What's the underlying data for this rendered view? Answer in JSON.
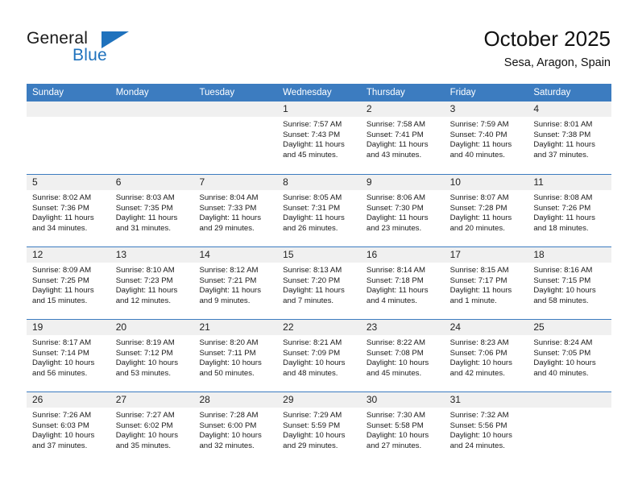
{
  "brand": {
    "name_top": "General",
    "name_bottom": "Blue",
    "accent_color": "#1f72bd"
  },
  "header": {
    "title": "October 2025",
    "location": "Sesa, Aragon, Spain"
  },
  "theme": {
    "header_blue": "#3c7cc0",
    "day_band_gray": "#f0f0f0",
    "text": "#1a1a1a"
  },
  "weekdays": [
    "Sunday",
    "Monday",
    "Tuesday",
    "Wednesday",
    "Thursday",
    "Friday",
    "Saturday"
  ],
  "weeks": [
    [
      {
        "day": "",
        "empty": true
      },
      {
        "day": "",
        "empty": true
      },
      {
        "day": "",
        "empty": true
      },
      {
        "day": "1",
        "sunrise": "Sunrise: 7:57 AM",
        "sunset": "Sunset: 7:43 PM",
        "daylight_1": "Daylight: 11 hours",
        "daylight_2": "and 45 minutes."
      },
      {
        "day": "2",
        "sunrise": "Sunrise: 7:58 AM",
        "sunset": "Sunset: 7:41 PM",
        "daylight_1": "Daylight: 11 hours",
        "daylight_2": "and 43 minutes."
      },
      {
        "day": "3",
        "sunrise": "Sunrise: 7:59 AM",
        "sunset": "Sunset: 7:40 PM",
        "daylight_1": "Daylight: 11 hours",
        "daylight_2": "and 40 minutes."
      },
      {
        "day": "4",
        "sunrise": "Sunrise: 8:01 AM",
        "sunset": "Sunset: 7:38 PM",
        "daylight_1": "Daylight: 11 hours",
        "daylight_2": "and 37 minutes."
      }
    ],
    [
      {
        "day": "5",
        "sunrise": "Sunrise: 8:02 AM",
        "sunset": "Sunset: 7:36 PM",
        "daylight_1": "Daylight: 11 hours",
        "daylight_2": "and 34 minutes."
      },
      {
        "day": "6",
        "sunrise": "Sunrise: 8:03 AM",
        "sunset": "Sunset: 7:35 PM",
        "daylight_1": "Daylight: 11 hours",
        "daylight_2": "and 31 minutes."
      },
      {
        "day": "7",
        "sunrise": "Sunrise: 8:04 AM",
        "sunset": "Sunset: 7:33 PM",
        "daylight_1": "Daylight: 11 hours",
        "daylight_2": "and 29 minutes."
      },
      {
        "day": "8",
        "sunrise": "Sunrise: 8:05 AM",
        "sunset": "Sunset: 7:31 PM",
        "daylight_1": "Daylight: 11 hours",
        "daylight_2": "and 26 minutes."
      },
      {
        "day": "9",
        "sunrise": "Sunrise: 8:06 AM",
        "sunset": "Sunset: 7:30 PM",
        "daylight_1": "Daylight: 11 hours",
        "daylight_2": "and 23 minutes."
      },
      {
        "day": "10",
        "sunrise": "Sunrise: 8:07 AM",
        "sunset": "Sunset: 7:28 PM",
        "daylight_1": "Daylight: 11 hours",
        "daylight_2": "and 20 minutes."
      },
      {
        "day": "11",
        "sunrise": "Sunrise: 8:08 AM",
        "sunset": "Sunset: 7:26 PM",
        "daylight_1": "Daylight: 11 hours",
        "daylight_2": "and 18 minutes."
      }
    ],
    [
      {
        "day": "12",
        "sunrise": "Sunrise: 8:09 AM",
        "sunset": "Sunset: 7:25 PM",
        "daylight_1": "Daylight: 11 hours",
        "daylight_2": "and 15 minutes."
      },
      {
        "day": "13",
        "sunrise": "Sunrise: 8:10 AM",
        "sunset": "Sunset: 7:23 PM",
        "daylight_1": "Daylight: 11 hours",
        "daylight_2": "and 12 minutes."
      },
      {
        "day": "14",
        "sunrise": "Sunrise: 8:12 AM",
        "sunset": "Sunset: 7:21 PM",
        "daylight_1": "Daylight: 11 hours",
        "daylight_2": "and 9 minutes."
      },
      {
        "day": "15",
        "sunrise": "Sunrise: 8:13 AM",
        "sunset": "Sunset: 7:20 PM",
        "daylight_1": "Daylight: 11 hours",
        "daylight_2": "and 7 minutes."
      },
      {
        "day": "16",
        "sunrise": "Sunrise: 8:14 AM",
        "sunset": "Sunset: 7:18 PM",
        "daylight_1": "Daylight: 11 hours",
        "daylight_2": "and 4 minutes."
      },
      {
        "day": "17",
        "sunrise": "Sunrise: 8:15 AM",
        "sunset": "Sunset: 7:17 PM",
        "daylight_1": "Daylight: 11 hours",
        "daylight_2": "and 1 minute."
      },
      {
        "day": "18",
        "sunrise": "Sunrise: 8:16 AM",
        "sunset": "Sunset: 7:15 PM",
        "daylight_1": "Daylight: 10 hours",
        "daylight_2": "and 58 minutes."
      }
    ],
    [
      {
        "day": "19",
        "sunrise": "Sunrise: 8:17 AM",
        "sunset": "Sunset: 7:14 PM",
        "daylight_1": "Daylight: 10 hours",
        "daylight_2": "and 56 minutes."
      },
      {
        "day": "20",
        "sunrise": "Sunrise: 8:19 AM",
        "sunset": "Sunset: 7:12 PM",
        "daylight_1": "Daylight: 10 hours",
        "daylight_2": "and 53 minutes."
      },
      {
        "day": "21",
        "sunrise": "Sunrise: 8:20 AM",
        "sunset": "Sunset: 7:11 PM",
        "daylight_1": "Daylight: 10 hours",
        "daylight_2": "and 50 minutes."
      },
      {
        "day": "22",
        "sunrise": "Sunrise: 8:21 AM",
        "sunset": "Sunset: 7:09 PM",
        "daylight_1": "Daylight: 10 hours",
        "daylight_2": "and 48 minutes."
      },
      {
        "day": "23",
        "sunrise": "Sunrise: 8:22 AM",
        "sunset": "Sunset: 7:08 PM",
        "daylight_1": "Daylight: 10 hours",
        "daylight_2": "and 45 minutes."
      },
      {
        "day": "24",
        "sunrise": "Sunrise: 8:23 AM",
        "sunset": "Sunset: 7:06 PM",
        "daylight_1": "Daylight: 10 hours",
        "daylight_2": "and 42 minutes."
      },
      {
        "day": "25",
        "sunrise": "Sunrise: 8:24 AM",
        "sunset": "Sunset: 7:05 PM",
        "daylight_1": "Daylight: 10 hours",
        "daylight_2": "and 40 minutes."
      }
    ],
    [
      {
        "day": "26",
        "sunrise": "Sunrise: 7:26 AM",
        "sunset": "Sunset: 6:03 PM",
        "daylight_1": "Daylight: 10 hours",
        "daylight_2": "and 37 minutes."
      },
      {
        "day": "27",
        "sunrise": "Sunrise: 7:27 AM",
        "sunset": "Sunset: 6:02 PM",
        "daylight_1": "Daylight: 10 hours",
        "daylight_2": "and 35 minutes."
      },
      {
        "day": "28",
        "sunrise": "Sunrise: 7:28 AM",
        "sunset": "Sunset: 6:00 PM",
        "daylight_1": "Daylight: 10 hours",
        "daylight_2": "and 32 minutes."
      },
      {
        "day": "29",
        "sunrise": "Sunrise: 7:29 AM",
        "sunset": "Sunset: 5:59 PM",
        "daylight_1": "Daylight: 10 hours",
        "daylight_2": "and 29 minutes."
      },
      {
        "day": "30",
        "sunrise": "Sunrise: 7:30 AM",
        "sunset": "Sunset: 5:58 PM",
        "daylight_1": "Daylight: 10 hours",
        "daylight_2": "and 27 minutes."
      },
      {
        "day": "31",
        "sunrise": "Sunrise: 7:32 AM",
        "sunset": "Sunset: 5:56 PM",
        "daylight_1": "Daylight: 10 hours",
        "daylight_2": "and 24 minutes."
      },
      {
        "day": "",
        "empty": true
      }
    ]
  ]
}
